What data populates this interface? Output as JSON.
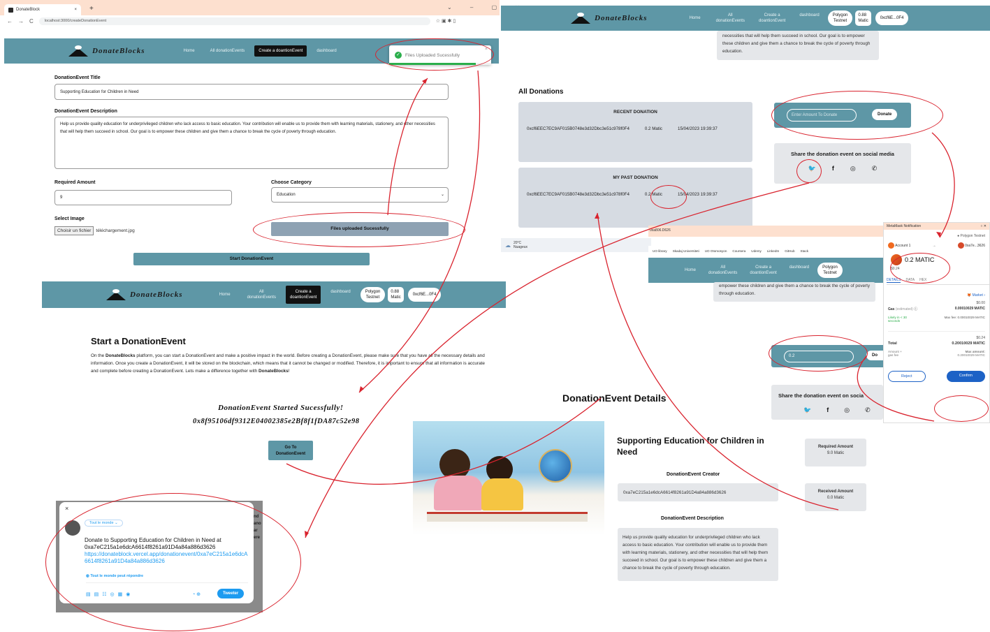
{
  "browser": {
    "tab_title": "DonateBlock",
    "url": "localhost:3000/createDonationEvent",
    "tab_add": "+"
  },
  "brand": {
    "name": "DonateBlocks",
    "nav_color": "#5e97a6",
    "accent_red": "#d9232e",
    "confirm_blue": "#1d62c6"
  },
  "nav": {
    "home": "Home",
    "all": "All donationEvents",
    "all_l1": "All",
    "all_l2": "donationEvents",
    "create": "Create a doantionEvent",
    "create_l1": "Create a",
    "create_l2": "doantionEvent",
    "dashboard": "dashboard",
    "network_l1": "Polygon",
    "network_l2": "Testnet",
    "balance_l1": "0.88",
    "balance_l2": "Matic",
    "account": "0xcf6E...0F4"
  },
  "toast": {
    "text": "Files Uploaded Sucessfully",
    "close": "×",
    "progress_percent": 85
  },
  "form": {
    "title_label": "DonationEvent Title",
    "title_value": "Supporting Education for Children in Need",
    "desc_label": "DonationEvent Description",
    "desc_value": "Help us provide quality education for underprivileged children who lack access to basic education. Your contribution will enable us to provide them with learning materials, stationery, and other necessities that will help them succeed in school. Our goal is to empower these children and give them a chance to break the cycle of poverty through education.",
    "amount_label": "Required Amount",
    "amount_value": "9",
    "category_label": "Choose Category",
    "category_value": "Education",
    "image_label": "Select Image",
    "file_button": "Choisir un fichier",
    "file_name": "téléchargement.jpg",
    "uploaded_button": "Files uploaded Sucessfully",
    "start_button": "Start DonationEvent"
  },
  "start_section": {
    "heading": "Start a DonationEvent",
    "intro_pre": "On the ",
    "intro_brand": "DonateBlocks",
    "intro_mid": " platform, you can start a DonationEvent and make a positive impact in the world. Before creating a DonationEvent, please make sure that you have all the necessary details and information. Once you create a DonationEvent, it will be stored on the blockchain, which means that it cannot be changed or modified. Therefore, it is important to ensure that all information is accurate and complete before creating a DonationEvent. Lets make a difference together with ",
    "intro_end": "DonateBlocks",
    "intro_bang": "!",
    "started": "DonationEvent Started Sucessfully!",
    "tx_hash": "0x8f95106df9312E04002385e2Bf8f1fDA87c52e98",
    "goto_l1": "Go To",
    "goto_l2": "DonationEvent"
  },
  "tweet": {
    "audience": "Tout le monde",
    "text_pre": "Donate to Supporting Education for Children in Need at 0xa7eC215a1e6dcA6614f8261a91D4a84a886d3626",
    "link": "https://donateblock.vercel.app/donationevent/0xa7eC215a1e6dcA6614f8261a91D4a84a886d3626",
    "reply": "Tout le monde peut répondre",
    "button": "Tweeter",
    "side_l1": "nd",
    "side_l2": "ano",
    "side_l3": "ar",
    "side_l4": "ere"
  },
  "right_top": {
    "desc_tail": "necessities that will help them succeed in school. Our goal is to empower these children and give them a chance to break the cycle of poverty through education.",
    "all_donations": "All Donations",
    "recent_title": "RECENT DONATION",
    "my_title": "MY PAST DONATION",
    "donor": "0xcf6EEC7EC9AF015B0748e3d32Dbc3e51c978f0F4",
    "amount": "0.2 Matic",
    "date": "15/04/2023 19:39:37",
    "amount_placeholder": "Enter Amount To Donate",
    "donate_button": "Donate",
    "share_title": "Share the donation event on social media",
    "weather_temp": "20°C",
    "weather_desc": "Nuageux"
  },
  "second_window": {
    "url": "0xa806.D626",
    "bookmarks": [
      "UO library",
      "Skadaj Universiteti",
      "UO Otomosyon",
      "Coursera",
      "Udemy",
      "LinkedIn",
      "GitHub",
      "Stack"
    ],
    "desc_tail": "empower these children and give them a chance to break the cycle of poverty through education.",
    "amount_value": "0.2",
    "donate_cut": "Do",
    "share_title": "Share the donation event on socia"
  },
  "metamask": {
    "title": "MetaMask Notification",
    "network": "Polygon Testnet",
    "account": "Account 1",
    "to": "0xa7e...3626",
    "amount": "0.2 MATIC",
    "usd": "$0.24",
    "tabs": [
      "DETAILS",
      "DATA",
      "HEX"
    ],
    "market": "Market",
    "gas_label": "Gas",
    "gas_est": "(estimated)",
    "gas_usd": "$0.00",
    "gas_matic": "0.00010029 MATIC",
    "likely": "Likely in < 30 seconds",
    "max_fee": "Max fee: 0.00010029 MATIC",
    "total_usd": "$0.24",
    "total_label": "Total",
    "total_matic": "0.20010029 MATIC",
    "amount_gas": "Amount + gas fee",
    "max_amount_label": "Max amount:",
    "max_amount": "0.20010029 MATIC",
    "reject": "Reject",
    "confirm": "Confirm"
  },
  "details": {
    "heading": "DonationEvent Details",
    "title": "Supporting Education for Children in Need",
    "creator_label": "DonationEvent Creator",
    "creator": "0xa7eC215a1e6dcA6614f8261a91D4a84a886d3626",
    "desc_label": "DonationEvent Description",
    "desc": "Help us provide quality education for underprivileged children who lack access to basic education. Your contribution will enable us to provide them with learning materials, stationery, and other necessities that will help them succeed in school. Our goal is to empower these children and give them a chance to break the cycle of poverty through education.",
    "required_label": "Required Amount",
    "required_value": "9.0 Matic",
    "received_label": "Received Amount",
    "received_value": "0.0 Matic"
  }
}
